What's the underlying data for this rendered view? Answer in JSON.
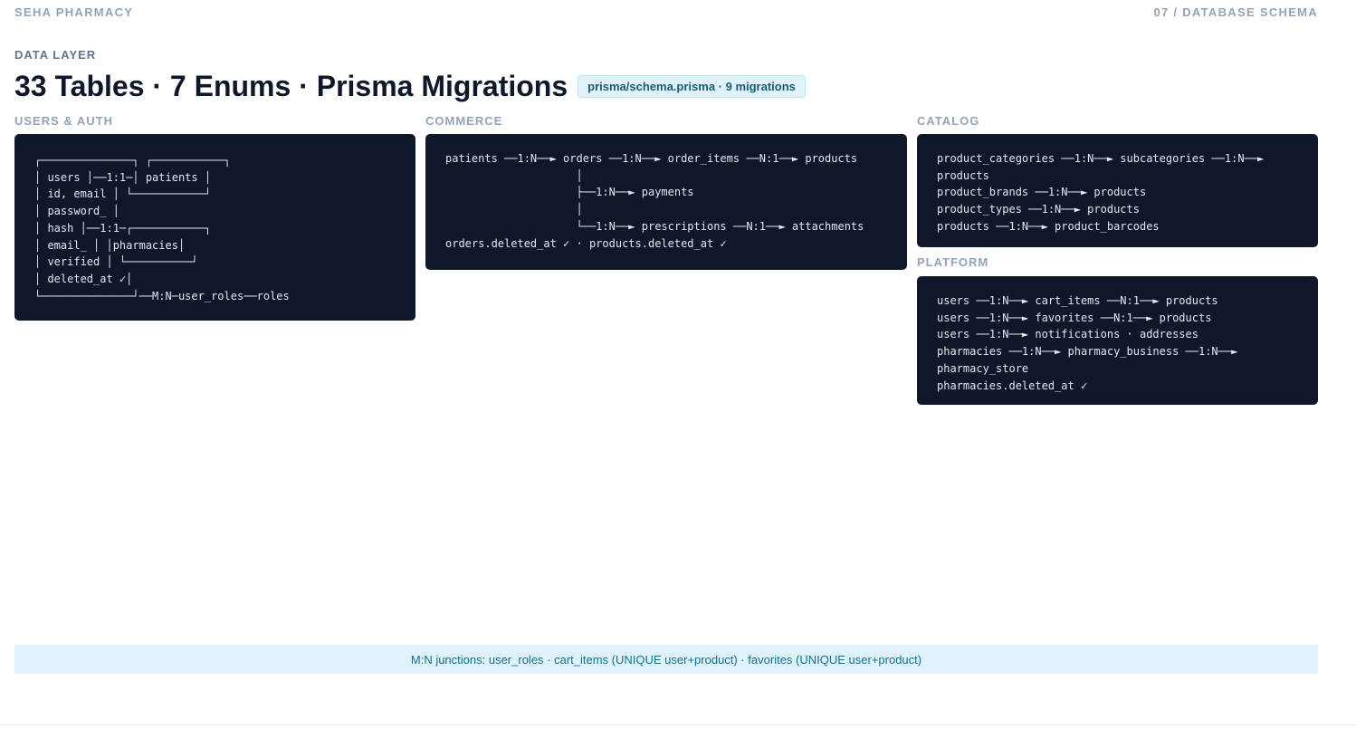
{
  "header": {
    "brand": "SEHA PHARMACY",
    "slide": "07 / DATABASE SCHEMA"
  },
  "eyebrow": "DATA LAYER",
  "title": "33 Tables · 7 Enums · Prisma Migrations",
  "badge": "prisma/schema.prisma · 9 migrations",
  "sections": {
    "users_auth": {
      "label": "USERS & AUTH",
      "diagram": "┌──────────────┐ ┌───────────┐\n│ users │──1:1─│ patients │\n│ id, email │ └───────────┘\n│ password_ │\n│ hash │──1:1─┌───────────┐\n│ email_ │ │pharmacies│\n│ verified │ └──────────┘\n│ deleted_at ✓│\n└──────────────┘──M:N─user_roles──roles"
    },
    "commerce": {
      "label": "COMMERCE",
      "diagram": "patients ──1:N──► orders ──1:N──► order_items ──N:1──► products\n                    │\n                    ├──1:N──► payments\n                    │\n                    └──1:N──► prescriptions ──N:1──► attachments\norders.deleted_at ✓ · products.deleted_at ✓"
    },
    "catalog": {
      "label": "CATALOG",
      "diagram": "product_categories ──1:N──► subcategories ──1:N──►\nproducts\nproduct_brands ──1:N──► products\nproduct_types ──1:N──► products\nproducts ──1:N──► product_barcodes"
    },
    "platform": {
      "label": "PLATFORM",
      "diagram": "users ──1:N──► cart_items ──N:1──► products\nusers ──1:N──► favorites ──N:1──► products\nusers ──1:N──► notifications · addresses\npharmacies ──1:N──► pharmacy_business ──1:N──►\npharmacy_store\npharmacies.deleted_at ✓"
    }
  },
  "footer_note": "M:N junctions: user_roles · cart_items (UNIQUE user+product) · favorites (UNIQUE user+product)"
}
